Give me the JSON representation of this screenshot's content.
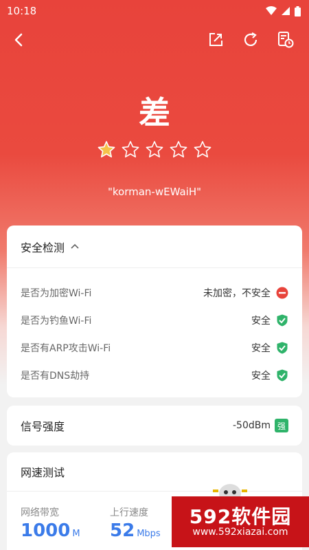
{
  "status_bar": {
    "time": "10:18"
  },
  "toolbar": {
    "back": "back",
    "share": "share",
    "refresh": "refresh",
    "report": "report"
  },
  "result": {
    "grade": "差",
    "rating": {
      "value": 1,
      "max": 5
    },
    "ssid": "\"korman-wEWaiH\""
  },
  "security": {
    "title": "安全检测",
    "items": [
      {
        "label": "是否为加密Wi-Fi",
        "value": "未加密，不安全",
        "status": "danger"
      },
      {
        "label": "是否为钓鱼Wi-Fi",
        "value": "安全",
        "status": "safe"
      },
      {
        "label": "是否有ARP攻击Wi-Fi",
        "value": "安全",
        "status": "safe"
      },
      {
        "label": "是否有DNS劫持",
        "value": "安全",
        "status": "safe"
      }
    ]
  },
  "signal": {
    "title": "信号强度",
    "value": "-50dBm",
    "badge": "强"
  },
  "speed_test": {
    "title": "网速测试",
    "bandwidth": {
      "label": "网络带宽",
      "value": "1000",
      "unit": "M"
    },
    "upload": {
      "label": "上行速度",
      "value": "52",
      "unit": "Mbps"
    }
  },
  "watermark": {
    "brand": "592软件园",
    "url": "www.592xiazai.com"
  },
  "colors": {
    "hero": "#e8433b",
    "accent_blue": "#3b7be9",
    "safe_green": "#2fb36a",
    "danger_red": "#e8433b",
    "star": "#f5c24a"
  }
}
